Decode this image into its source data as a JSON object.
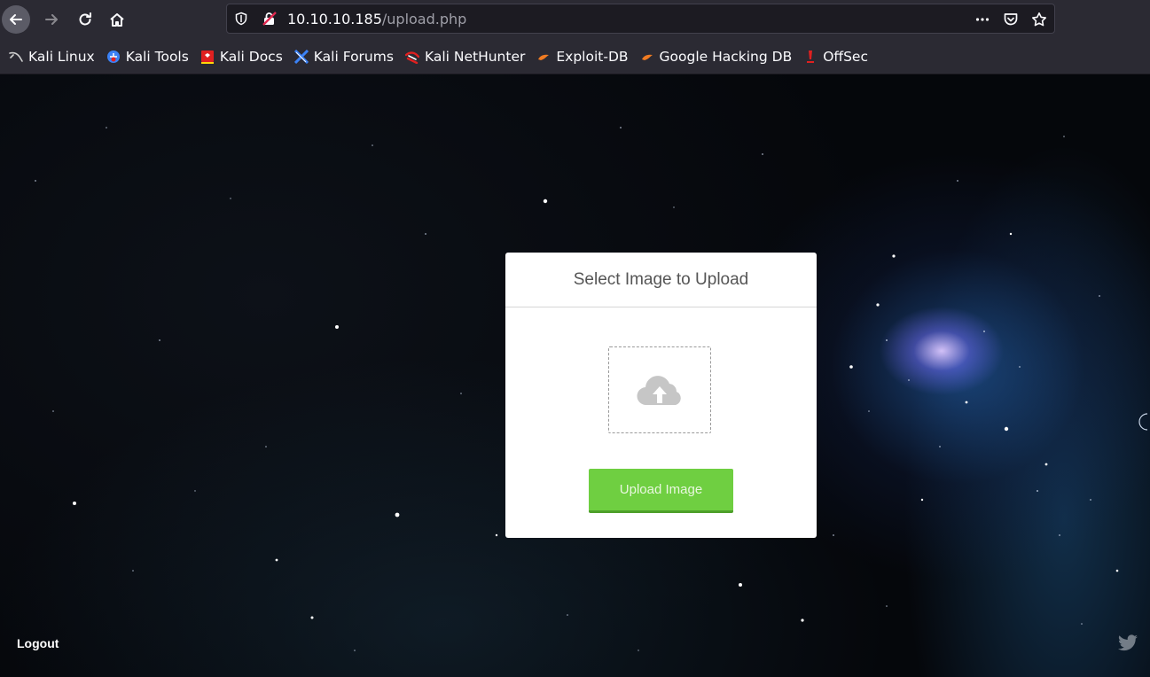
{
  "browser": {
    "url_host": "10.10.10.185",
    "url_path": "/upload.php",
    "bookmarks": [
      {
        "label": "Kali Linux",
        "icon": "kali-dragon-icon",
        "color": "#cccccc"
      },
      {
        "label": "Kali Tools",
        "icon": "kali-tools-icon",
        "color": "#3b82f6"
      },
      {
        "label": "Kali Docs",
        "icon": "kali-docs-icon",
        "color": "#e02020"
      },
      {
        "label": "Kali Forums",
        "icon": "kali-forums-icon",
        "color": "#3b82f6"
      },
      {
        "label": "Kali NetHunter",
        "icon": "kali-nethunter-icon",
        "color": "#e02020"
      },
      {
        "label": "Exploit-DB",
        "icon": "exploit-db-icon",
        "color": "#f07b22"
      },
      {
        "label": "Google Hacking DB",
        "icon": "ghdb-icon",
        "color": "#f07b22"
      },
      {
        "label": "OffSec",
        "icon": "offsec-icon",
        "color": "#e02020"
      }
    ]
  },
  "page": {
    "card_title": "Select Image to Upload",
    "upload_button": "Upload Image",
    "logout": "Logout",
    "accent_color": "#6fcf41"
  }
}
